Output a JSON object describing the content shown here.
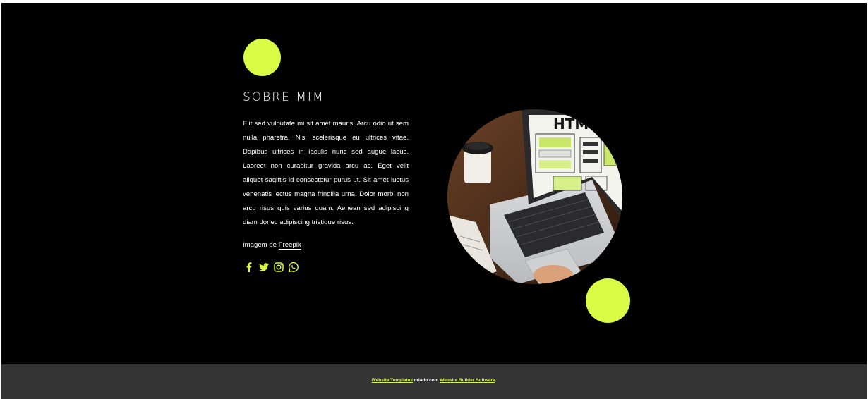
{
  "about": {
    "title": "SOBRE MIM",
    "paragraph": "Elit sed vulputate mi sit amet mauris. Arcu odio ut sem nulla pharetra. Nisi scelerisque eu ultrices vitae. Dapibus ultrices in iaculis nunc sed augue lacus. Laoreet non curabitur gravida arcu ac. Eget velit aliquet sagittis id consectetur purus ut. Sit amet luctus venenatis lectus magna fringilla urna. Dolor morbi non arcu risus quis varius quam. Aenean sed adipiscing diam donec adipiscing tristique risus.",
    "image_credit_prefix": "Imagem de ",
    "image_credit_link": "Freepik",
    "social_icons": [
      "facebook-icon",
      "twitter-icon",
      "instagram-icon",
      "whatsapp-icon"
    ],
    "photo_screen_text": "HTML"
  },
  "footer": {
    "link1": "Website Templates",
    "middle": " criado com ",
    "link2": "Website Builder Software",
    "end": "."
  },
  "colors": {
    "accent": "#d9fb45",
    "background": "#000000",
    "footer_bg": "#333333",
    "text": "#ffffff"
  }
}
